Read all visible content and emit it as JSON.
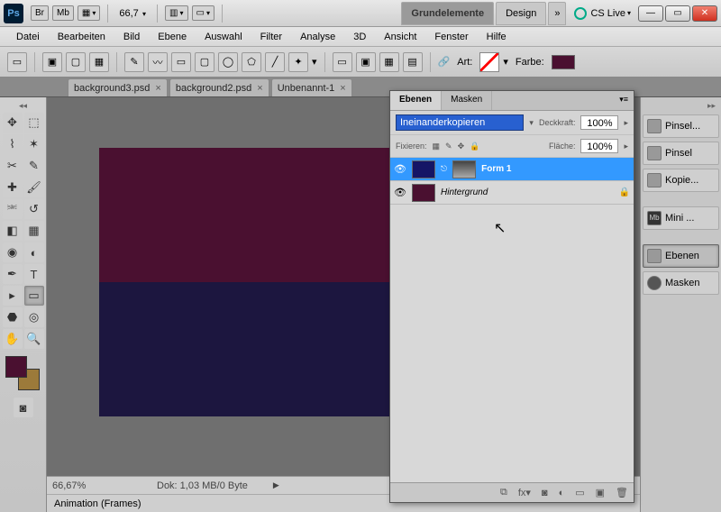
{
  "titlebar": {
    "ps": "Ps",
    "br": "Br",
    "mb": "Mb",
    "zoom": "66,7",
    "ws_active": "Grundelemente",
    "ws_design": "Design",
    "more": "»",
    "cslive": "CS Live"
  },
  "menu": {
    "datei": "Datei",
    "bearbeiten": "Bearbeiten",
    "bild": "Bild",
    "ebene": "Ebene",
    "auswahl": "Auswahl",
    "filter": "Filter",
    "analyse": "Analyse",
    "dreid": "3D",
    "ansicht": "Ansicht",
    "fenster": "Fenster",
    "hilfe": "Hilfe"
  },
  "options": {
    "art": "Art:",
    "farbe": "Farbe:",
    "farbe_hex": "#4a1030"
  },
  "tabs": {
    "t1": "background3.psd",
    "t2": "background2.psd",
    "t3": "Unbenannt-1"
  },
  "canvas": {
    "top_color": "#4a1030",
    "bottom_color": "#1c163f"
  },
  "colors": {
    "fg": "#4a1030",
    "bg": "#9c7a3a"
  },
  "status": {
    "zoom": "66,67%",
    "doc": "Dok: 1,03 MB/0 Byte",
    "anim": "Animation (Frames)"
  },
  "layers": {
    "tab_ebenen": "Ebenen",
    "tab_masken": "Masken",
    "blend": "Ineinanderkopieren",
    "deckkraft": "Deckkraft:",
    "deckkraft_val": "100%",
    "fixieren": "Fixieren:",
    "flaeche": "Fläche:",
    "flaeche_val": "100%",
    "l1_name": "Form 1",
    "l1_color": "#151566",
    "l2_name": "Hintergrund",
    "l2_color": "#4a1030"
  },
  "rightdock": {
    "pinsel1": "Pinsel...",
    "pinsel2": "Pinsel",
    "kopie": "Kopie...",
    "mini": "Mini ...",
    "ebenen": "Ebenen",
    "masken": "Masken",
    "mb": "Mb"
  }
}
